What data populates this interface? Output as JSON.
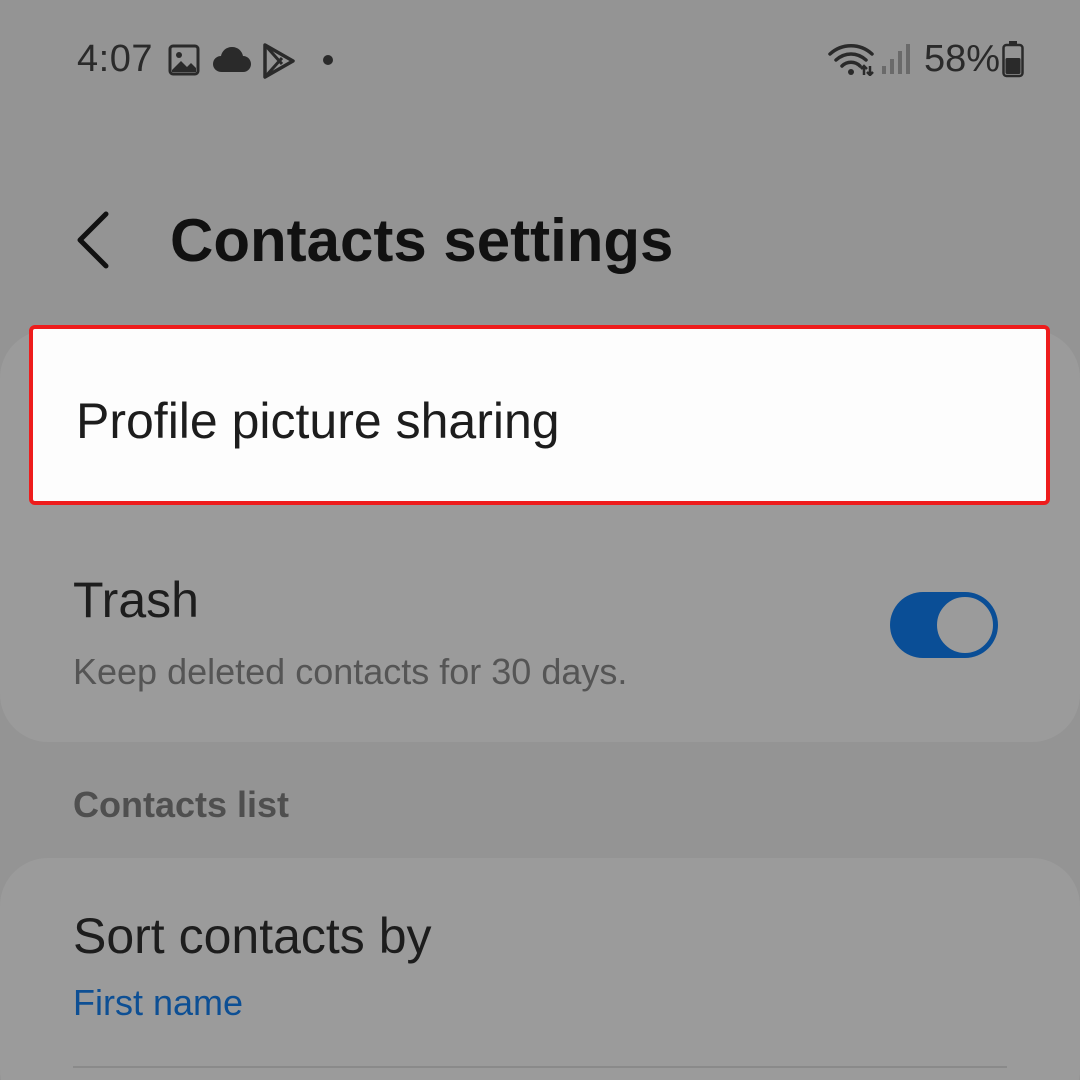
{
  "status_bar": {
    "time": "4:07",
    "battery_percent": "58%",
    "notification_icons": [
      "gallery-icon",
      "cloud-icon",
      "play-store-icon",
      "dot-icon"
    ],
    "system_icons": [
      "wifi-icon",
      "signal-icon",
      "battery-icon"
    ]
  },
  "header": {
    "back_icon": "chevron-left-icon",
    "title": "Contacts settings"
  },
  "settings": {
    "profile_picture_sharing": {
      "label": "Profile picture sharing"
    },
    "trash": {
      "label": "Trash",
      "description": "Keep deleted contacts for 30 days.",
      "enabled": true
    }
  },
  "contacts_list": {
    "section_title": "Contacts list",
    "sort_contacts_by": {
      "label": "Sort contacts by",
      "value": "First name"
    }
  },
  "colors": {
    "background": "#949494",
    "highlight_border": "#ee1c1c",
    "toggle_on": "#0a4e96",
    "link_value": "#0d4f94"
  }
}
